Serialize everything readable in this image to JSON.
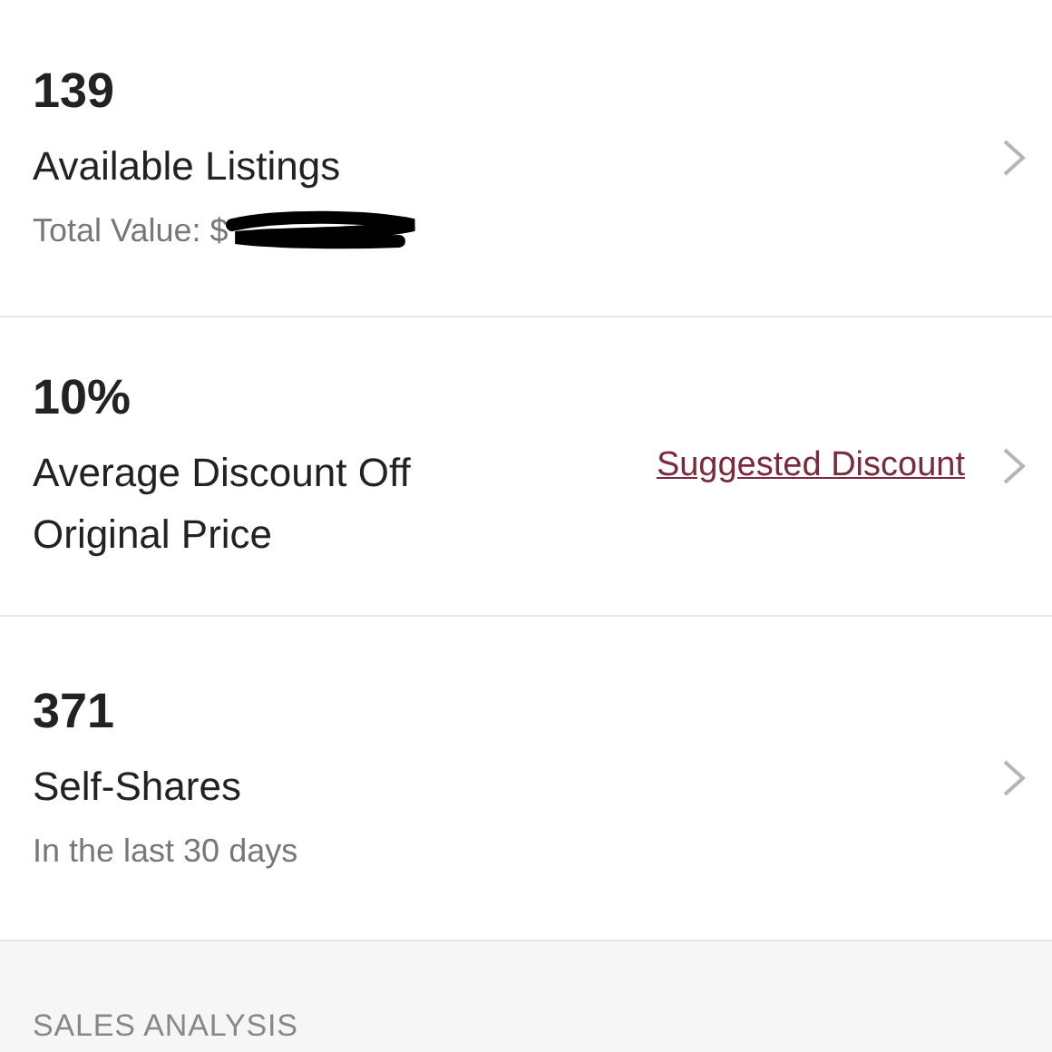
{
  "stats": [
    {
      "value": "139",
      "title": "Available Listings",
      "subtitle": "Total Value: $",
      "redacted": true
    },
    {
      "value": "10%",
      "title": "Average Discount Off Original Price",
      "link": "Suggested Discount"
    },
    {
      "value": "371",
      "title": "Self-Shares",
      "subtitle": "In the last 30 days"
    }
  ],
  "section_header": "SALES ANALYSIS"
}
